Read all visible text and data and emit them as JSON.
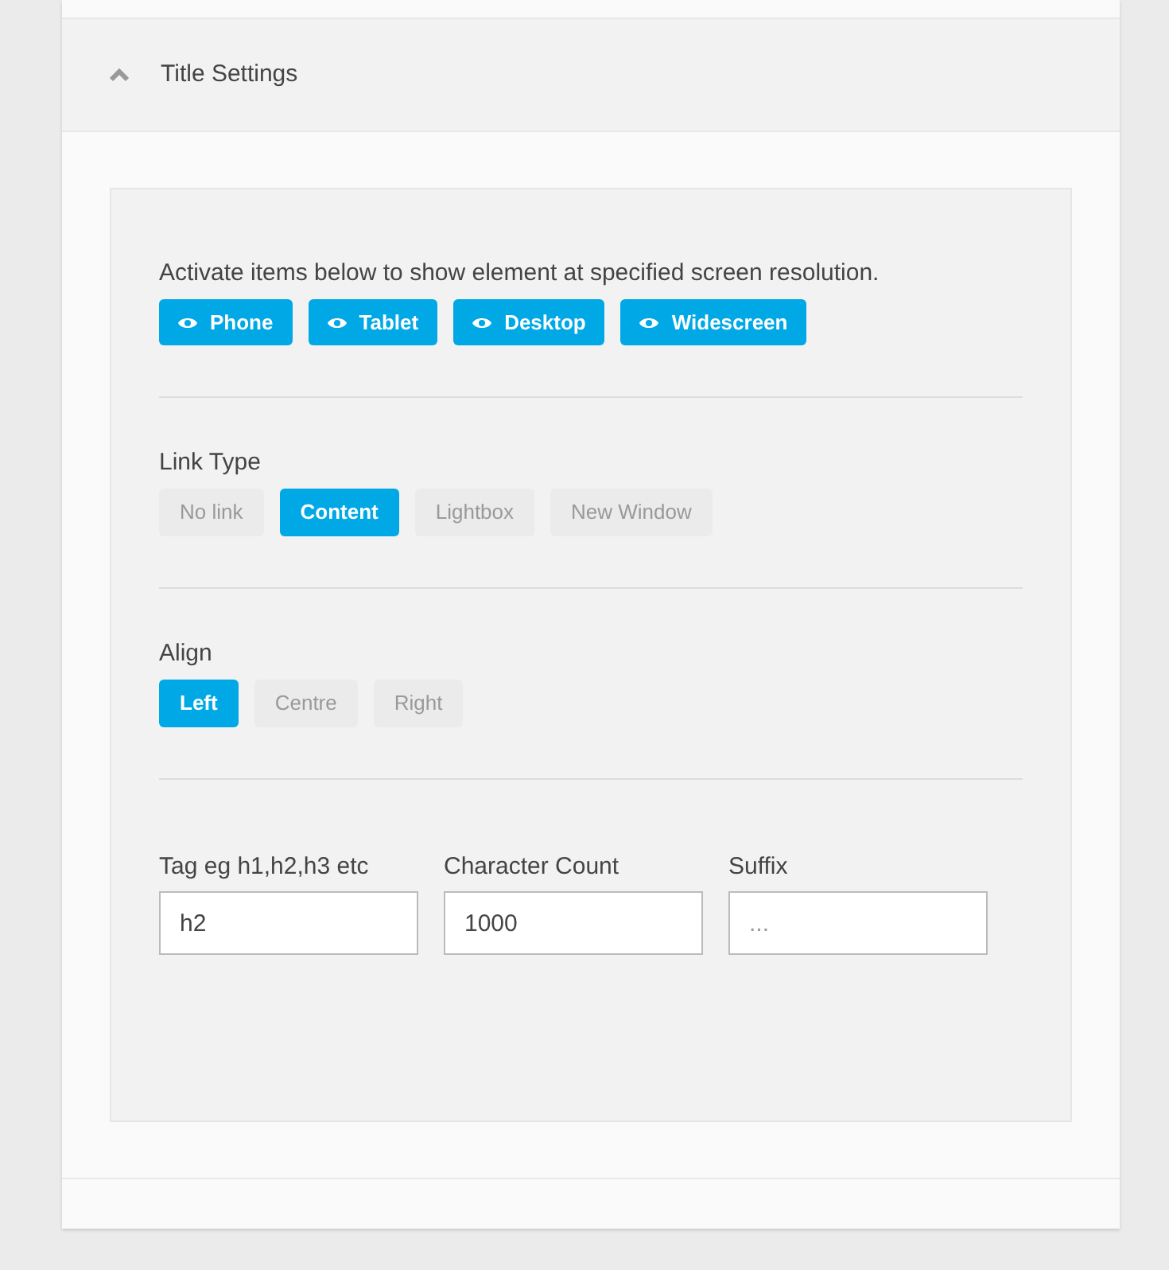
{
  "section": {
    "title": "Title Settings",
    "expanded": true
  },
  "visibility": {
    "label": "Activate items below to show element at specified screen resolution.",
    "items": [
      {
        "label": "Phone",
        "on": true
      },
      {
        "label": "Tablet",
        "on": true
      },
      {
        "label": "Desktop",
        "on": true
      },
      {
        "label": "Widescreen",
        "on": true
      }
    ]
  },
  "link_type": {
    "label": "Link Type",
    "options": [
      {
        "label": "No link",
        "selected": false
      },
      {
        "label": "Content",
        "selected": true
      },
      {
        "label": "Lightbox",
        "selected": false
      },
      {
        "label": "New Window",
        "selected": false
      }
    ]
  },
  "align": {
    "label": "Align",
    "options": [
      {
        "label": "Left",
        "selected": true
      },
      {
        "label": "Centre",
        "selected": false
      },
      {
        "label": "Right",
        "selected": false
      }
    ]
  },
  "fields": [
    {
      "label": "Tag eg h1,h2,h3 etc",
      "value": "h2"
    },
    {
      "label": "Character Count",
      "value": "1000"
    },
    {
      "label": "Suffix",
      "placeholder": "..."
    }
  ]
}
